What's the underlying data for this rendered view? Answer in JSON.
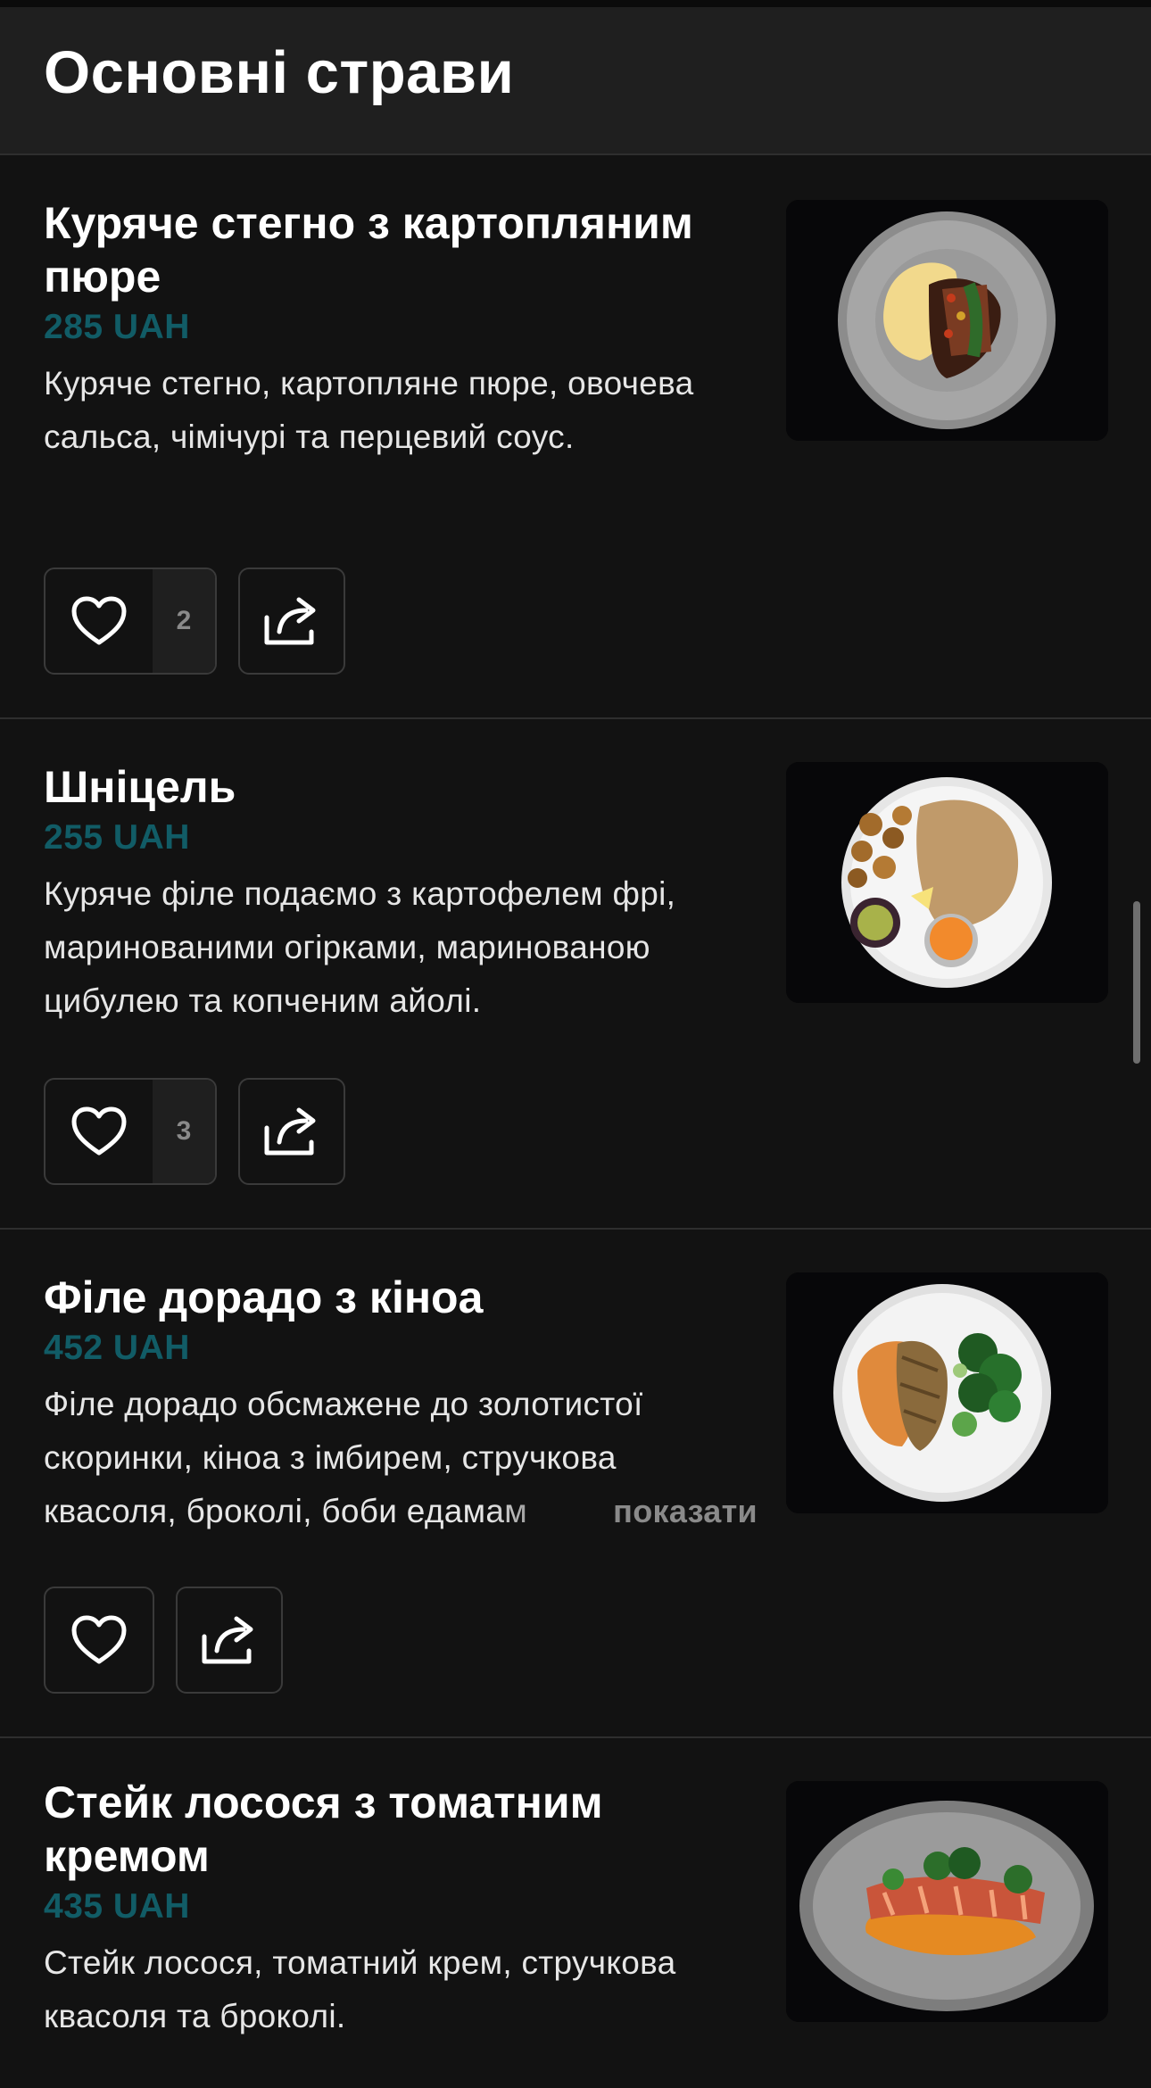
{
  "section": {
    "title": "Основні страви"
  },
  "items": [
    {
      "title": "Куряче стегно з картопляним пюре",
      "price": "285 UAH",
      "description": "Куряче стегно, картопляне пюре, овочева сальса, чімічурі та перцевий соус.",
      "likes": "2"
    },
    {
      "title": "Шніцель",
      "price": "255 UAH",
      "description": "Куряче філе подаємо з картофелем фрі, маринованими огірками, маринованою цибулею та копченим айолі.",
      "likes": "3"
    },
    {
      "title": "Філе дорадо з кіноа",
      "price": "452 UAH",
      "description": "Філе дорадо обсмажене до золотистої скоринки, кіноа з імбирем, стручкова квасоля, броколі, боби едамам",
      "show_more": "показати"
    },
    {
      "title": "Стейк лосося з томатним кремом",
      "price": "435 UAH",
      "description": "Стейк лосося, томатний крем, стручкова квасоля та броколі."
    }
  ],
  "icons": {
    "like": "heart-icon",
    "share": "share-icon"
  },
  "colors": {
    "background": "#121212",
    "header": "#1f1f1f",
    "price": "#115c66",
    "border": "#3a3a3a"
  }
}
